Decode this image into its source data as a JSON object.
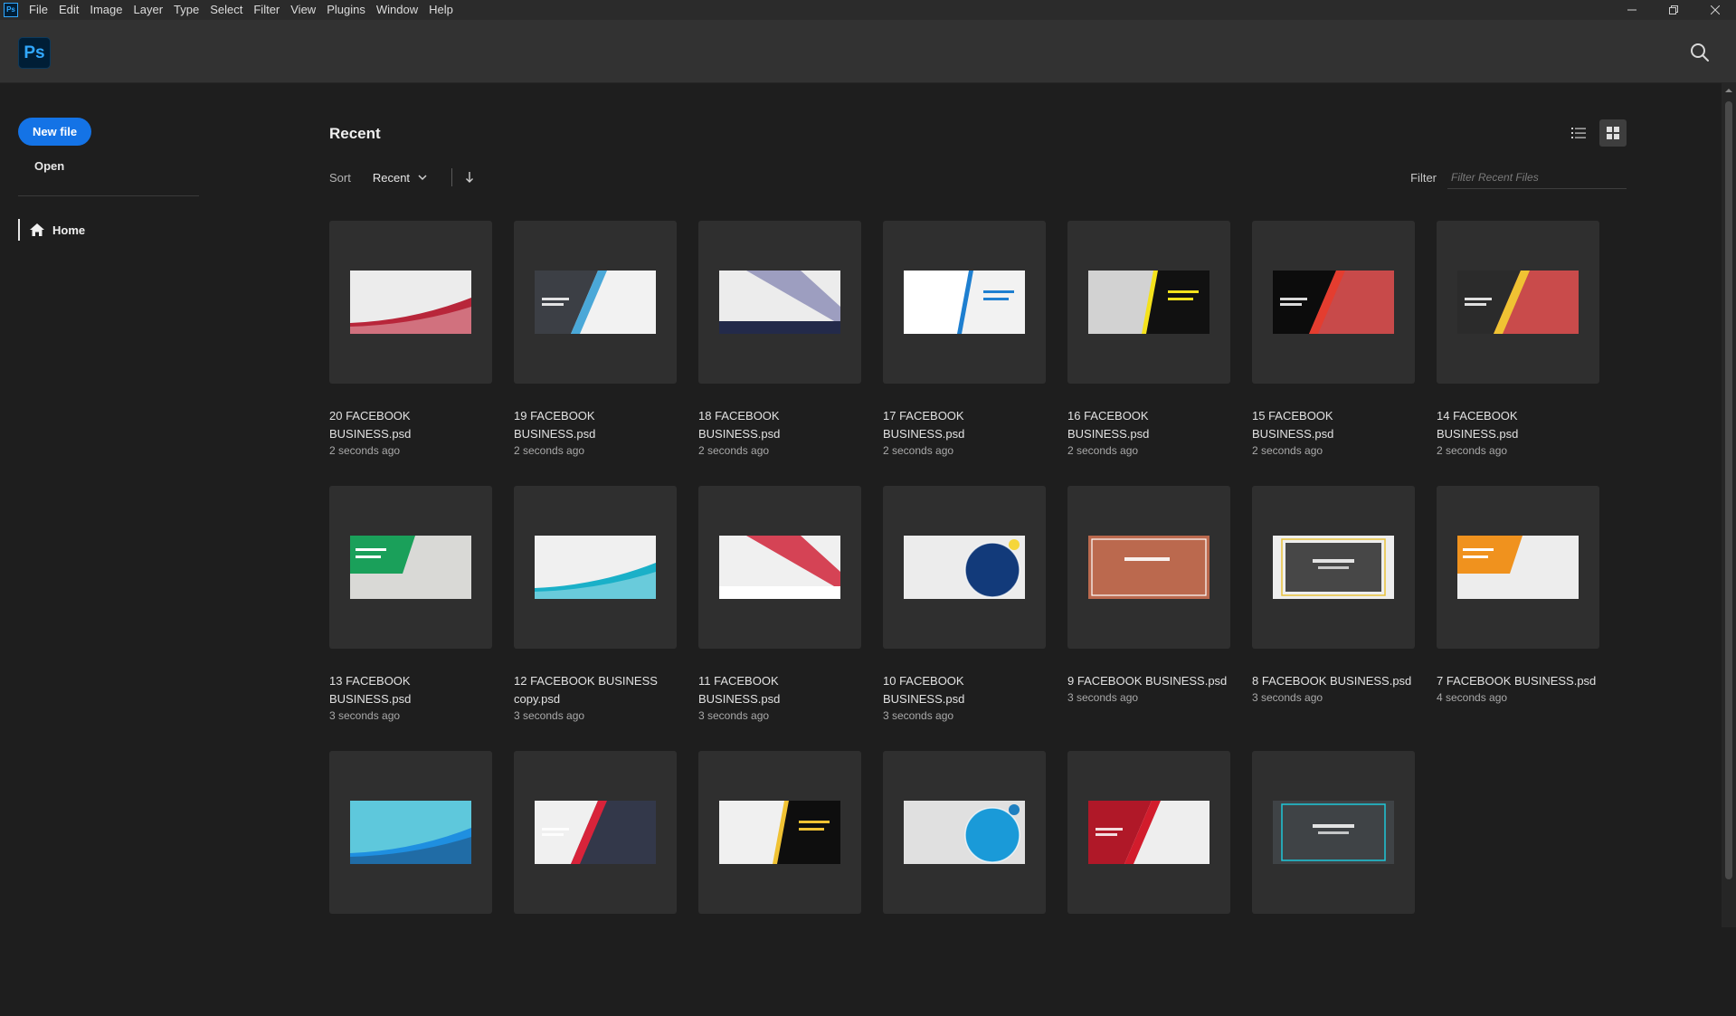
{
  "app": {
    "icon_text": "Ps",
    "logo_text": "Ps"
  },
  "menu": [
    {
      "label": "File"
    },
    {
      "label": "Edit"
    },
    {
      "label": "Image"
    },
    {
      "label": "Layer"
    },
    {
      "label": "Type"
    },
    {
      "label": "Select"
    },
    {
      "label": "Filter"
    },
    {
      "label": "View"
    },
    {
      "label": "Plugins"
    },
    {
      "label": "Window"
    },
    {
      "label": "Help"
    }
  ],
  "window_controls": [
    "minimize-icon",
    "restore-icon",
    "close-icon"
  ],
  "sidebar": {
    "new_file_label": "New file",
    "open_label": "Open",
    "nav": [
      {
        "label": "Home",
        "icon": "home-icon",
        "active": true
      }
    ]
  },
  "main": {
    "title": "Recent",
    "sort_label": "Sort",
    "sort_value": "Recent",
    "sort_direction_icon": "arrow-down-icon",
    "view_modes": [
      {
        "icon": "list-view-icon",
        "active": false
      },
      {
        "icon": "grid-view-icon",
        "active": true
      }
    ],
    "filter_label": "Filter",
    "filter_placeholder": "Filter Recent Files",
    "files": [
      {
        "name": "20 FACEBOOK BUSINESS.psd",
        "time": "2 seconds ago",
        "thumb": {
          "bg": "#ececec",
          "accent": "#b8263a",
          "dark": "#ffffff",
          "style": "wave"
        }
      },
      {
        "name": "19 FACEBOOK BUSINESS.psd",
        "time": "2 seconds ago",
        "thumb": {
          "bg": "#f2f2f2",
          "accent": "#4aa8d8",
          "dark": "#3c3f45",
          "style": "diag"
        }
      },
      {
        "name": "18 FACEBOOK BUSINESS.psd",
        "time": "2 seconds ago",
        "thumb": {
          "bg": "#ececec",
          "accent": "#8f90b8",
          "dark": "#232a4a",
          "style": "band"
        }
      },
      {
        "name": "17 FACEBOOK BUSINESS.psd",
        "time": "2 seconds ago",
        "thumb": {
          "bg": "#ffffff",
          "accent": "#1e7fd0",
          "dark": "#f2f2f2",
          "style": "split"
        }
      },
      {
        "name": "16 FACEBOOK BUSINESS.psd",
        "time": "2 seconds ago",
        "thumb": {
          "bg": "#d2d2d2",
          "accent": "#f4e21c",
          "dark": "#111111",
          "style": "split"
        }
      },
      {
        "name": "15 FACEBOOK BUSINESS.psd",
        "time": "2 seconds ago",
        "thumb": {
          "bg": "#c84a4a",
          "accent": "#e43d2f",
          "dark": "#0c0c0c",
          "style": "diag"
        }
      },
      {
        "name": "14 FACEBOOK BUSINESS.psd",
        "time": "2 seconds ago",
        "thumb": {
          "bg": "#c94b4b",
          "accent": "#f0c233",
          "dark": "#2b2b2b",
          "style": "diag"
        }
      },
      {
        "name": "13 FACEBOOK BUSINESS.psd",
        "time": "3 seconds ago",
        "thumb": {
          "bg": "#d9d9d6",
          "accent": "#1aa05a",
          "dark": "#e8e8e6",
          "style": "corner"
        }
      },
      {
        "name": "12 FACEBOOK BUSINESS copy.psd",
        "time": "3 seconds ago",
        "thumb": {
          "bg": "#f0f0f0",
          "accent": "#1ab0c8",
          "dark": "#ffffff",
          "style": "wave"
        }
      },
      {
        "name": "11 FACEBOOK BUSINESS.psd",
        "time": "3 seconds ago",
        "thumb": {
          "bg": "#f0f0f0",
          "accent": "#d0243a",
          "dark": "#ffffff",
          "style": "band"
        }
      },
      {
        "name": "10 FACEBOOK BUSINESS.psd",
        "time": "3 seconds ago",
        "thumb": {
          "bg": "#ececec",
          "accent": "#123a7a",
          "dark": "#f5d63a",
          "style": "circle"
        }
      },
      {
        "name": "9 FACEBOOK BUSINESS.psd",
        "time": "3 seconds ago",
        "thumb": {
          "bg": "#7a3a8c",
          "accent": "#f0901c",
          "dark": "#5a2a78",
          "style": "gradient"
        }
      },
      {
        "name": "8 FACEBOOK BUSINESS.psd",
        "time": "3 seconds ago",
        "thumb": {
          "bg": "#eeeeee",
          "accent": "#e8c23a",
          "dark": "#474747",
          "style": "frame"
        }
      },
      {
        "name": "7 FACEBOOK BUSINESS.psd",
        "time": "4 seconds ago",
        "thumb": {
          "bg": "#ededed",
          "accent": "#f0921e",
          "dark": "#e87e14",
          "style": "corner"
        }
      },
      {
        "name": "",
        "time": "",
        "thumb": {
          "bg": "#5ec8dc",
          "accent": "#1f8fe0",
          "dark": "#232a3a",
          "style": "wave"
        }
      },
      {
        "name": "",
        "time": "",
        "thumb": {
          "bg": "#33384a",
          "accent": "#d8233a",
          "dark": "#f0f0f0",
          "style": "diag"
        }
      },
      {
        "name": "",
        "time": "",
        "thumb": {
          "bg": "#f0f0f0",
          "accent": "#f0c233",
          "dark": "#0e0e0e",
          "style": "split"
        }
      },
      {
        "name": "",
        "time": "",
        "thumb": {
          "bg": "#e0e0e0",
          "accent": "#1a9ad8",
          "dark": "#1e7fc0",
          "style": "circle"
        }
      },
      {
        "name": "",
        "time": "",
        "thumb": {
          "bg": "#eeeeee",
          "accent": "#d21c2c",
          "dark": "#b01828",
          "style": "diag"
        }
      },
      {
        "name": "",
        "time": "",
        "thumb": {
          "bg": "#3f4346",
          "accent": "#1fc8d8",
          "dark": "#3f4346",
          "style": "frame"
        }
      }
    ]
  }
}
